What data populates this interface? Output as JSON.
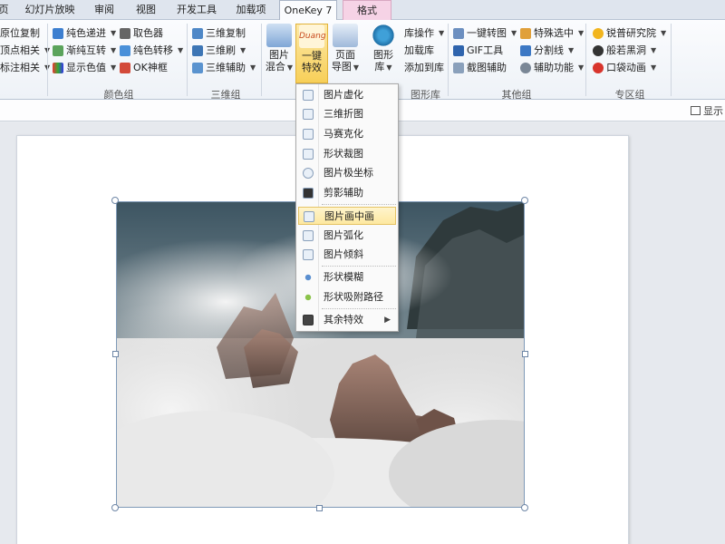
{
  "tabs": [
    "页",
    "幻灯片放映",
    "审阅",
    "视图",
    "开发工具",
    "加载项",
    "OneKey 7",
    "格式"
  ],
  "ribbon": {
    "left_items": [
      "原位复制",
      "顶点相关",
      "标注相关"
    ],
    "color_group": {
      "label": "颜色组",
      "items": [
        "纯色递进",
        "取色器",
        "渐纯互转",
        "纯色转移",
        "显示色值",
        "OK神框"
      ]
    },
    "threed_group": {
      "label": "三维组",
      "items": [
        "三维复制",
        "三维刷",
        "三维辅助"
      ]
    },
    "big_buttons": {
      "picture_mix": [
        "图片",
        "混合"
      ],
      "one_click": [
        "一键",
        "特效"
      ],
      "one_click_icon_text": "Duang",
      "page_guide": [
        "页面",
        "导图"
      ],
      "shape_lib": [
        "图形",
        "库"
      ]
    },
    "lib_items": [
      "库操作",
      "加载库",
      "添加到库"
    ],
    "lib_group_label": "图形库",
    "other_group": {
      "label": "其他组",
      "items": [
        "一键转图",
        "特殊选中",
        "GIF工具",
        "分割线",
        "截图辅助",
        "辅助功能"
      ]
    },
    "special_group": {
      "label": "专区组",
      "items": [
        "锐普研究院",
        "般若黑洞",
        "口袋动画"
      ]
    }
  },
  "display_label": "显示",
  "menu": {
    "items": [
      "图片虚化",
      "三维折图",
      "马赛克化",
      "形状裁图",
      "图片极坐标",
      "剪影辅助",
      "图片画中画",
      "图片弧化",
      "图片倾斜",
      "形状模糊",
      "形状吸附路径",
      "其余特效"
    ],
    "highlighted": "图片画中画"
  }
}
